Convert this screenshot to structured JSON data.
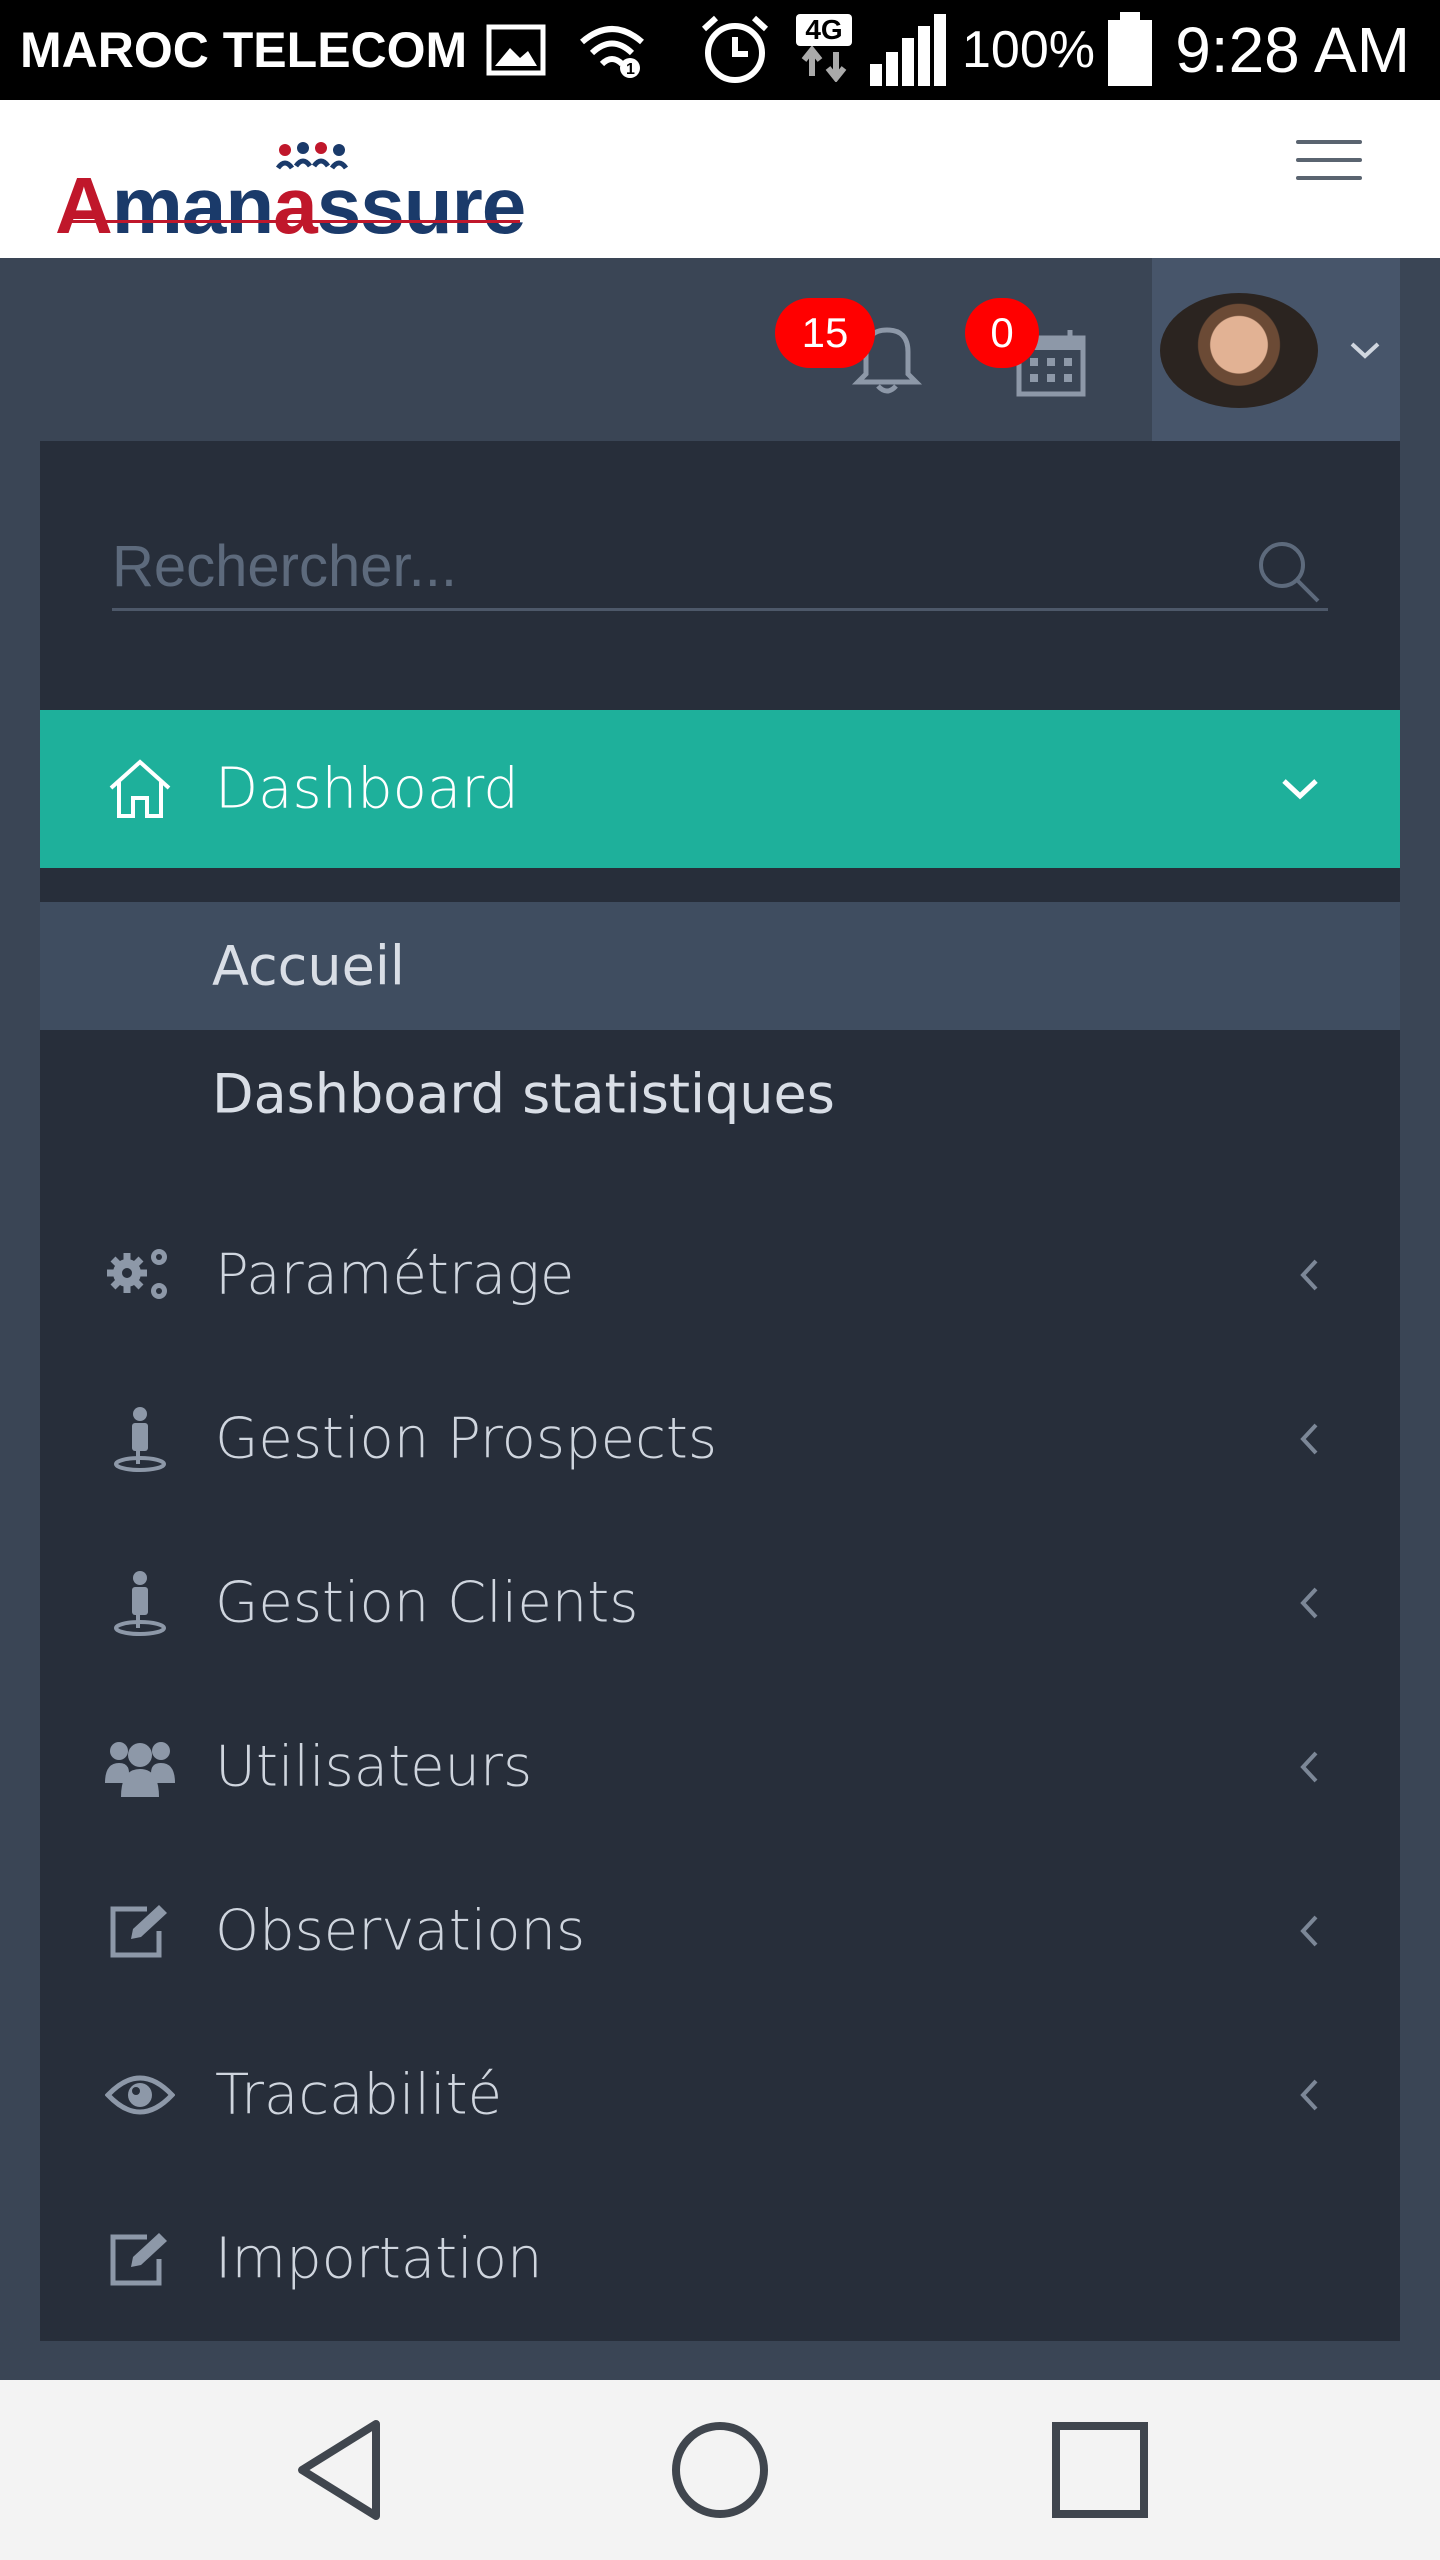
{
  "statusbar": {
    "carrier": "MAROC TELECOM",
    "network": "4G",
    "battery": "100%",
    "time": "9:28 AM"
  },
  "header": {
    "logo_first": "A",
    "logo_rest_1": "man",
    "logo_a": "a",
    "logo_rest_2": "ssure"
  },
  "toolbar": {
    "notifications_count": "15",
    "calendar_count": "0"
  },
  "search": {
    "placeholder": "Rechercher..."
  },
  "menu": {
    "dashboard": "Dashboard",
    "sub_items": [
      "Accueil",
      "Dashboard statistiques"
    ],
    "items": [
      {
        "label": "Paramétrage",
        "icon": "gears-icon"
      },
      {
        "label": "Gestion Prospects",
        "icon": "person-pin-icon"
      },
      {
        "label": "Gestion Clients",
        "icon": "person-pin-icon"
      },
      {
        "label": "Utilisateurs",
        "icon": "users-icon"
      },
      {
        "label": "Observations",
        "icon": "edit-icon"
      },
      {
        "label": "Tracabilité",
        "icon": "eye-icon"
      },
      {
        "label": "Importation",
        "icon": "edit-icon"
      }
    ]
  },
  "colors": {
    "accent": "#1eb09b",
    "panel": "#272e3a",
    "frame": "#3a4555",
    "badge": "#ff0000",
    "brand_red": "#c0172b",
    "brand_blue": "#1a3a6a"
  }
}
